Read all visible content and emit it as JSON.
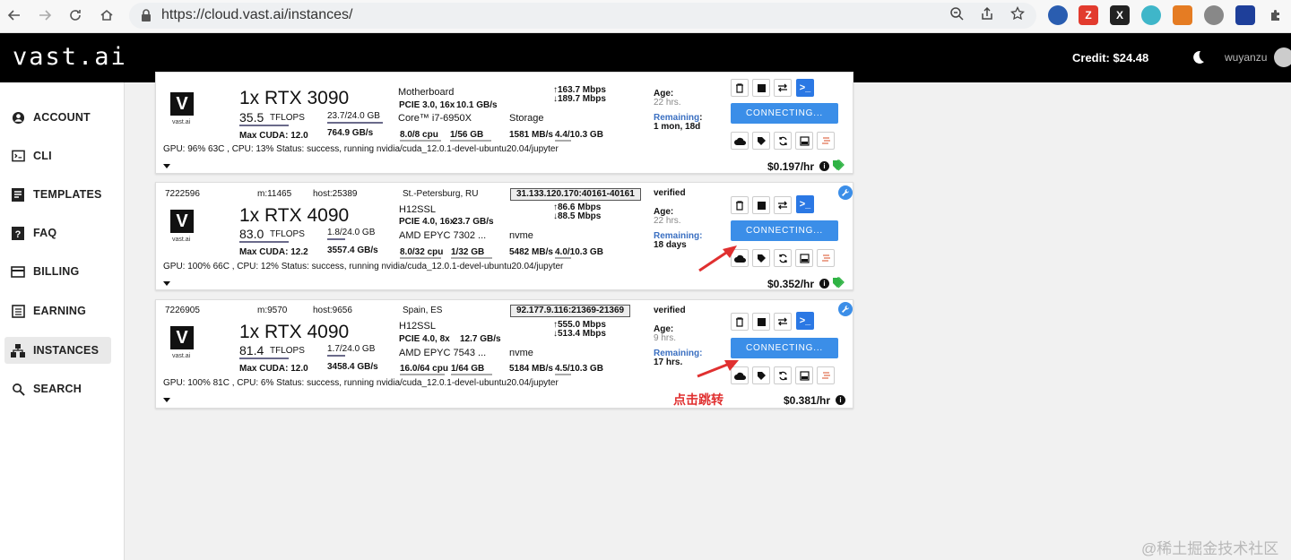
{
  "browser": {
    "url": "https://cloud.vast.ai/instances/"
  },
  "header": {
    "logo": "vast.ai",
    "credit": "Credit: $24.48",
    "username": "wuyanzu"
  },
  "sidebar": {
    "items": [
      {
        "label": "ACCOUNT",
        "icon": "account-icon"
      },
      {
        "label": "CLI",
        "icon": "terminal-icon"
      },
      {
        "label": "TEMPLATES",
        "icon": "templates-icon"
      },
      {
        "label": "FAQ",
        "icon": "help-icon"
      },
      {
        "label": "BILLING",
        "icon": "credit-card-icon"
      },
      {
        "label": "EARNING",
        "icon": "list-icon"
      },
      {
        "label": "INSTANCES",
        "icon": "instances-icon",
        "active": true
      },
      {
        "label": "SEARCH",
        "icon": "search-icon"
      }
    ]
  },
  "instances": [
    {
      "gpu": "1x RTX 3090",
      "vlogo": "V",
      "vsub": "vast.ai",
      "tflops": "35.5",
      "tflops_label": "TFLOPS",
      "max_cuda": "Max CUDA: 12.0",
      "vram": "23.7/24.0 GB",
      "vram_bw": "764.9 GB/s",
      "mobo": "Motherboard",
      "pcie": "PCIE 3.0, 16x",
      "pcie_bw": "10.1 GB/s",
      "cpu_model": "Core™ i7-6950X",
      "cpu": "8.0/8 cpu",
      "ram": "1/56 GB",
      "disk_label": "Storage",
      "disk_bw": "1581 MB/s",
      "disk": "4.4/10.3 GB",
      "up": "163.7 Mbps",
      "down": "189.7 Mbps",
      "age_label": "Age:",
      "age": "22 hrs.",
      "remaining_label": "Remaining",
      "remaining": "1 mon, 18d",
      "status": "GPU: 96% 63C , CPU: 13%    Status: success, running nvidia/cuda_12.0.1-devel-ubuntu20.04/jupyter",
      "connect": "CONNECTING...",
      "price": "$0.197/hr"
    },
    {
      "id": "7222596",
      "machine": "m:11465",
      "host": "host:25389",
      "location": "St.-Petersburg, RU",
      "ip": "31.133.120.170:40161-40161",
      "verified": "verified",
      "gpu": "1x RTX 4090",
      "vlogo": "V",
      "vsub": "vast.ai",
      "tflops": "83.0",
      "tflops_label": "TFLOPS",
      "max_cuda": "Max CUDA: 12.2",
      "vram": "1.8/24.0 GB",
      "vram_bw": "3557.4 GB/s",
      "mobo": "H12SSL",
      "pcie": "PCIE 4.0, 16x",
      "pcie_bw": "23.7 GB/s",
      "cpu_model": "AMD EPYC 7302 ...",
      "cpu": "8.0/32 cpu",
      "ram": "1/32 GB",
      "disk_label": "nvme",
      "disk_bw": "5482 MB/s",
      "disk": "4.0/10.3 GB",
      "up": "86.6 Mbps",
      "down": "88.5 Mbps",
      "age_label": "Age:",
      "age": "22 hrs.",
      "remaining_label": "Remaining:",
      "remaining": "18 days",
      "status": "GPU: 100% 66C , CPU: 12%    Status: success, running nvidia/cuda_12.0.1-devel-ubuntu20.04/jupyter",
      "connect": "CONNECTING...",
      "price": "$0.352/hr"
    },
    {
      "id": "7226905",
      "machine": "m:9570",
      "host": "host:9656",
      "location": "Spain, ES",
      "ip": "92.177.9.116:21369-21369",
      "verified": "verified",
      "gpu": "1x RTX 4090",
      "vlogo": "V",
      "vsub": "vast.ai",
      "tflops": "81.4",
      "tflops_label": "TFLOPS",
      "max_cuda": "Max CUDA: 12.0",
      "vram": "1.7/24.0 GB",
      "vram_bw": "3458.4 GB/s",
      "mobo": "H12SSL",
      "pcie": "PCIE 4.0, 8x",
      "pcie_bw": "12.7 GB/s",
      "cpu_model": "AMD EPYC 7543 ...",
      "cpu": "16.0/64 cpu",
      "ram": "1/64 GB",
      "disk_label": "nvme",
      "disk_bw": "5184 MB/s",
      "disk": "4.5/10.3 GB",
      "up": "555.0 Mbps",
      "down": "513.4 Mbps",
      "age_label": "Age:",
      "age": "9 hrs.",
      "remaining_label": "Remaining:",
      "remaining": "17 hrs.",
      "status": "GPU: 100% 81C , CPU: 6%    Status: success, running nvidia/cuda_12.0.1-devel-ubuntu20.04/jupyter",
      "connect": "CONNECTING...",
      "price": "$0.381/hr"
    }
  ],
  "annotation": {
    "text": "点击跳转",
    "color": "#e03030"
  },
  "watermark": "@稀土掘金技术社区",
  "colors": {
    "accent": "#3b8ee8",
    "header_bg": "#000000",
    "tag_green": "#2fb344"
  }
}
